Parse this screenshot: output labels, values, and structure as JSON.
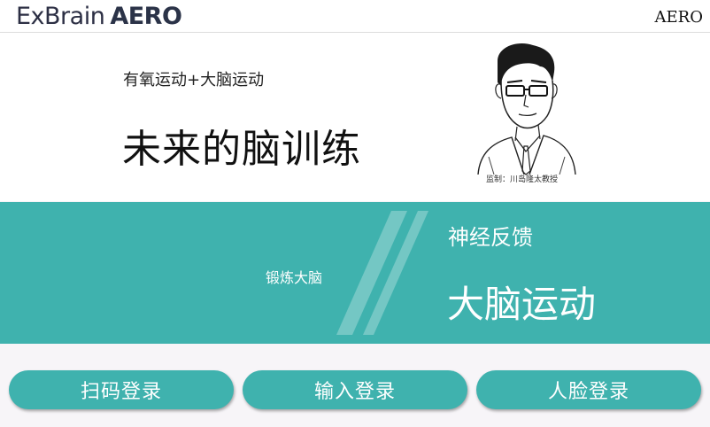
{
  "header": {
    "brand_part1": "ExBrain",
    "brand_part2": "AERO",
    "right_label": "AERO"
  },
  "hero": {
    "subtitle": "有氧运动+大脑运动",
    "title": "未来的脑训练",
    "caption": "监制：川岛隆太教授"
  },
  "band": {
    "small_label": "锻炼大脑",
    "label1": "神经反馈",
    "label2": "大脑运动"
  },
  "buttons": {
    "scan_login": "扫码登录",
    "input_login": "输入登录",
    "face_login": "人脸登录"
  },
  "colors": {
    "accent": "#3fb2ae",
    "band_text": "#ffffff"
  }
}
